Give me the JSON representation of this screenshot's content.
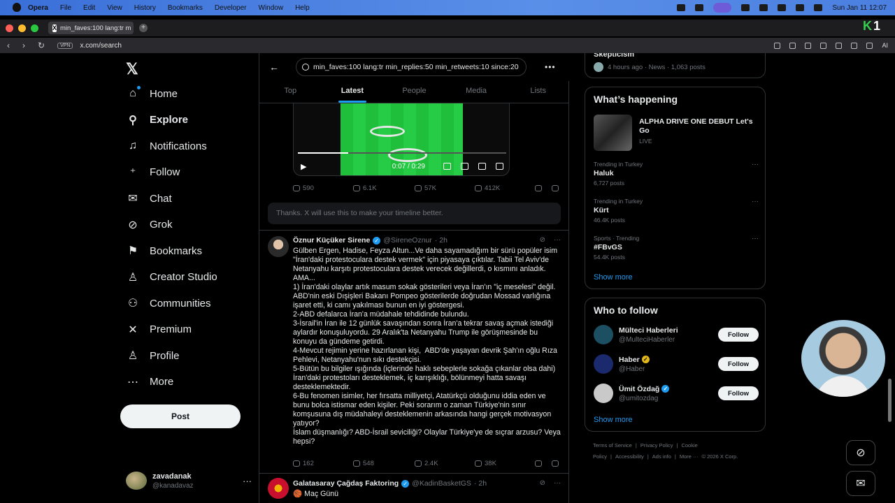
{
  "macos": {
    "menu": [
      "Opera",
      "File",
      "Edit",
      "View",
      "History",
      "Bookmarks",
      "Developer",
      "Window",
      "Help"
    ],
    "clock": "Sun Jan 11  12:07"
  },
  "browser": {
    "tab_title": "min_faves:100 lang:tr m",
    "url": "x.com/search",
    "vpn_label": "VPN",
    "ai_label": "AI",
    "badge_k": "K",
    "badge_1": "1"
  },
  "nav": {
    "items": [
      {
        "label": "Home",
        "icon": "home-icon"
      },
      {
        "label": "Explore",
        "icon": "search-icon"
      },
      {
        "label": "Notifications",
        "icon": "bell-icon"
      },
      {
        "label": "Follow",
        "icon": "add-person-icon"
      },
      {
        "label": "Chat",
        "icon": "mail-icon"
      },
      {
        "label": "Grok",
        "icon": "grok-icon"
      },
      {
        "label": "Bookmarks",
        "icon": "bookmark-icon"
      },
      {
        "label": "Creator Studio",
        "icon": "creator-icon"
      },
      {
        "label": "Communities",
        "icon": "communities-icon"
      },
      {
        "label": "Premium",
        "icon": "x-icon"
      },
      {
        "label": "Profile",
        "icon": "person-icon"
      },
      {
        "label": "More",
        "icon": "more-circle-icon"
      }
    ],
    "post_label": "Post",
    "account_name": "zavadanak",
    "account_handle": "@kanadavaz"
  },
  "search": {
    "query": "min_faves:100 lang:tr min_replies:50 min_retweets:10 since:20",
    "tabs": [
      "Top",
      "Latest",
      "People",
      "Media",
      "Lists"
    ],
    "active_tab": "Latest"
  },
  "video": {
    "time": "0:07 / 0:29",
    "progress": 0.24
  },
  "tweet1_actions": {
    "replies": "590",
    "reposts": "6.1K",
    "likes": "57K",
    "views": "412K"
  },
  "feedback_text": "Thanks. X will use this to make your timeline better.",
  "tweet2": {
    "name": "Öznur Küçüker Sirene",
    "handle": "@SireneOznur",
    "time": "· 2h",
    "text": "Gülben Ergen, Hadise, Feyza Altun...Ve daha sayamadığım bir sürü popüler isim \"İran'daki protestoculara destek vermek\" için piyasaya çıktılar. Tabii Tel Aviv'de Netanyahu karşıtı protestoculara destek verecek değillerdi, o kısmını anladık.\nAMA...\n1) İran'daki olaylar artık masum sokak gösterileri veya İran'ın \"iç meselesi\" değil. ABD'nin eski Dışişleri Bakanı Pompeo gösterilerde doğrudan Mossad varlığına işaret etti, ki camı yakılması bunun en iyi göstergesi.\n2-ABD defalarca İran'a müdahale tehdidinde bulundu.\n3-İsrail'in İran ile 12 günlük savaşından sonra İran'a tekrar savaş açmak istediği aylardır konuşuluyordu. 29 Aralık'ta Netanyahu Trump ile görüşmesinde bu konuyu da gündeme getirdi.\n4-Mevcut rejimin yerine hazırlanan kişi,  ABD'de yaşayan devrik Şah'ın oğlu Rıza Pehlevi, Netanyahu'nun sıkı destekçisi.\n5-Bütün bu bilgiler ışığında (içlerinde haklı sebeplerle sokağa çıkanlar olsa dahi) İran'daki protestoları desteklemek, iç karışıklığı, bölünmeyi hatta savaşı desteklemektedir.\n6-Bu fenomen isimler, her fırsatta milliyetçi, Atatürkçü olduğunu iddia eden ve bunu bolca istismar eden kişiler. Peki sorarım o zaman Türkiye'nin sınır komşusuna dış müdahaleyi desteklemenin arkasında hangi gerçek motivasyon yatıyor?\nİslam düşmanlığı? ABD-İsrail seviciliği? Olaylar Türkiye'ye de sıçrar arzusu? Veya hepsi?",
    "replies": "162",
    "reposts": "548",
    "likes": "2.4K",
    "views": "38K"
  },
  "tweet3": {
    "name": "Galatasaray Çağdaş Faktoring",
    "handle": "@KadinBasketGS",
    "time": "· 2h",
    "text": "🏀 Maç Günü"
  },
  "right": {
    "top_title": "Skepticism",
    "top_meta": "4 hours ago · News · 1,063 posts",
    "happening_title": "What’s happening",
    "featured_title": "ALPHA DRIVE ONE DEBUT Let's Go",
    "featured_status": "LIVE",
    "trends": [
      {
        "context": "Trending in Turkey",
        "name": "Haluk",
        "posts": "6,727 posts"
      },
      {
        "context": "Trending in Turkey",
        "name": "Kürt",
        "posts": "46.4K posts"
      },
      {
        "context": "Sports · Trending",
        "name": "#FBvGS",
        "posts": "54.4K posts"
      }
    ],
    "show_more": "Show more",
    "who_title": "Who to follow",
    "follow_label": "Follow",
    "suggestions": [
      {
        "name": "Mülteci Haberleri",
        "handle": "@MulteciHaberler",
        "badge": "",
        "color": "#1d4f63"
      },
      {
        "name": "Haber",
        "handle": "@Haber",
        "badge": "gold",
        "color": "#1a2a6c"
      },
      {
        "name": "Ümit Özdağ",
        "handle": "@umitozdag",
        "badge": "blue",
        "color": "#c9c9c9"
      }
    ],
    "footer": [
      "Terms of Service",
      "|",
      "Privacy Policy",
      "|",
      "Cookie Policy",
      "|",
      "Accessibility",
      "|",
      "Ads info",
      "|",
      "More ···",
      "© 2026 X Corp."
    ]
  }
}
